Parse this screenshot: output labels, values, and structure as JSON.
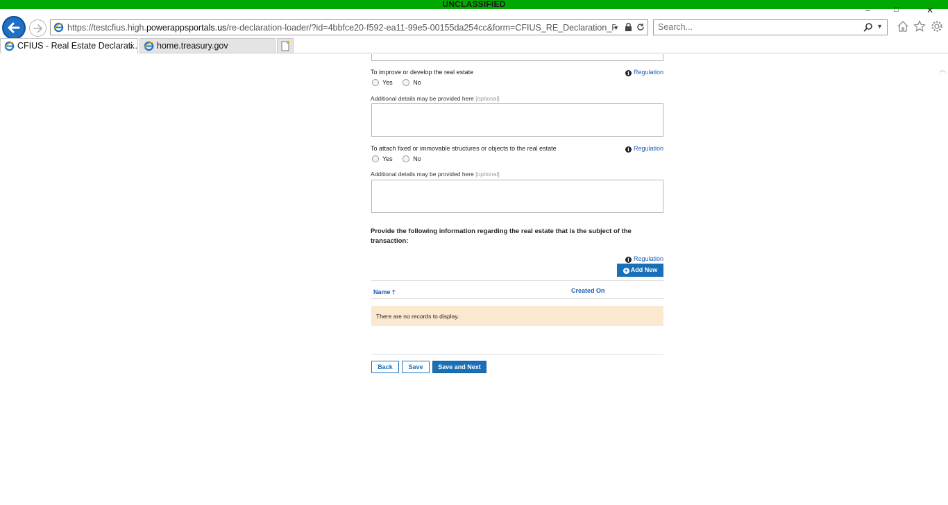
{
  "classification": "UNCLASSIFIED",
  "browser": {
    "window_controls": {
      "minimize": "–",
      "maximize": "□",
      "close": "✕"
    },
    "url_prefix": "https://testcfius.high.",
    "url_domain": "powerappsportals.us",
    "url_rest": "/re-declaration-loader/?id=4bbfce20-f592-ea11-99e5-00155da254cc&form=CFIUS_RE_Declaration_RealEsta",
    "search_placeholder": "Search...",
    "tabs": [
      {
        "label": "CFIUS - Real Estate Declarati...",
        "active": true
      },
      {
        "label": "home.treasury.gov",
        "active": false
      }
    ],
    "tab_close": "×"
  },
  "form": {
    "q_improve": "To improve or develop the real estate",
    "q_attach": "To attach fixed or immovable structures or objects to the real estate",
    "regulation_link": "Regulation",
    "radio_yes": "Yes",
    "radio_no": "No",
    "additional_details": "Additional details may be provided here",
    "optional": "[optional]",
    "provide_text": "Provide the following information regarding the real estate that is the subject of the transaction:",
    "add_new": "Add New",
    "table": {
      "columns": [
        "Name",
        "Created On"
      ],
      "empty_message": "There are no records to display."
    },
    "buttons": {
      "back": "Back",
      "save": "Save",
      "save_next": "Save and Next"
    }
  },
  "colors": {
    "classification_bar": "#00a800",
    "link": "#1a5db0",
    "primary": "#1a70b8",
    "empty_row": "#fbe9cf"
  }
}
